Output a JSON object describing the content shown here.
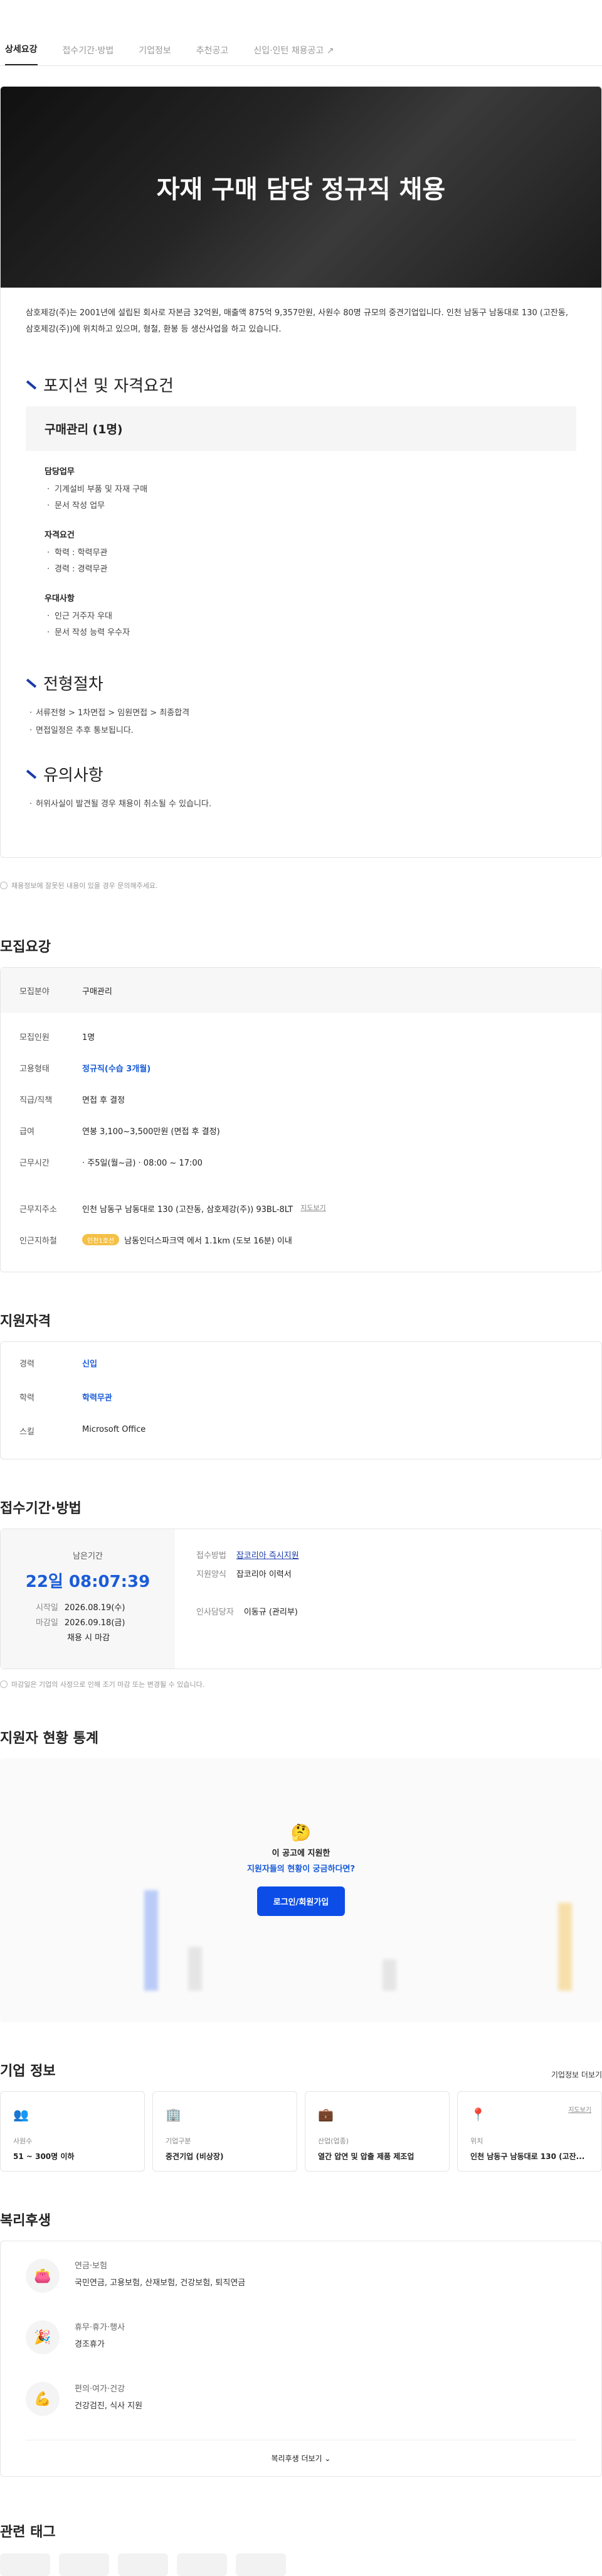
{
  "tabs": [
    "상세요강",
    "접수기간·방법",
    "기업정보",
    "추천공고",
    "신입·인턴 채용공고 ↗"
  ],
  "detail": {
    "hero_title": "자재 구매 담당 정규직 채용",
    "intro": "삼호제강(주)는 2001년에 설립된 회사로 자본금 32억원, 매출액 875억 9,357만원, 사원수 80명 규모의 중견기업입니다. 인천 남동구 남동대로 130 (고잔동, 삼호제강(주))에 위치하고 있으며, 형철, 환봉 등 생산사업을 하고 있습니다.",
    "position_heading": "포지션 및 자격요건",
    "position_title": "구매관리 (1명)",
    "sections": [
      {
        "title": "담당업무",
        "items": [
          "기계설비 부품 및 자재 구매",
          "문서 작성 업무"
        ]
      },
      {
        "title": "자격요건",
        "items": [
          "학력 : 학력무관",
          "경력 : 경력무관"
        ]
      },
      {
        "title": "우대사항",
        "items": [
          "인근 거주자 우대",
          "문서 작성 능력 우수자"
        ]
      }
    ],
    "process_heading": "전형절차",
    "process_items": [
      "서류전형 > 1차면접 > 임원면접 > 최종합격",
      "면접일정은 추후 통보됩니다."
    ],
    "caution_heading": "유의사항",
    "caution_items": [
      "허위사실이 발견될 경우 채용이 취소될 수 있습니다."
    ]
  },
  "notice_report": "채용정보에 잘못된 내용이 있을 경우 문의해주세요.",
  "recruit": {
    "heading": "모집요강",
    "rows": [
      {
        "k": "모집분야",
        "v": "구매관리"
      },
      {
        "k": "모집인원",
        "v": "1명"
      },
      {
        "k": "고용형태",
        "v": "정규직(수습 3개월)"
      },
      {
        "k": "직급/직책",
        "v": "면접 후 결정"
      },
      {
        "k": "급여",
        "v": "연봉 3,100~3,500만원 (면접 후 결정)"
      },
      {
        "k": "근무시간",
        "v": "· 주5일(월~금)  · 08:00 ~ 17:00"
      },
      {
        "k": "근무지주소",
        "v": "인천 남동구 남동대로 130 (고잔동, 삼호제강(주)) 93BL-8LT"
      },
      {
        "k": "인근지하철",
        "v": "남동인더스파크역 에서 1.1km (도보 16분) 이내"
      }
    ],
    "map_link": "지도보기",
    "subway_badge": "인천1호선"
  },
  "qualification": {
    "heading": "지원자격",
    "rows": [
      {
        "k": "경력",
        "v": "신입"
      },
      {
        "k": "학력",
        "v": "학력무관"
      },
      {
        "k": "스킬",
        "v": "Microsoft Office"
      }
    ]
  },
  "apply": {
    "heading": "접수기간·방법",
    "remain_label": "남은기간",
    "remain_value": "22일 08:07:39",
    "start_label": "시작일",
    "start_value": "2026.08.19(수)",
    "end_label": "마감일",
    "end_value": "2026.09.18(금)",
    "note": "채용 시 마감",
    "method_label": "접수방법",
    "method_value": "잡코리아 즉시지원",
    "form_label": "지원양식",
    "form_value": "잡코리아 이력서",
    "manager_label": "인사담당자",
    "manager_value": "이동규 (관리부)",
    "footnote": "마감일은 기업의 사정으로 인해 조기 마감 또는 변경될 수 있습니다."
  },
  "stats": {
    "heading": "지원자 현황 통계",
    "line1": "이 공고에 지원한",
    "line2": "지원자들의 현황이 궁금하다면?",
    "button": "로그인/회원가입"
  },
  "company": {
    "heading": "기업 정보",
    "more": "기업정보 더보기",
    "cards": [
      {
        "label": "사원수",
        "value": "51 ~ 300명 이하"
      },
      {
        "label": "기업구분",
        "value": "중견기업 (비상장)"
      },
      {
        "label": "산업(업종)",
        "value": "열간 압연 및 압출 제품 제조업"
      },
      {
        "label": "위치",
        "value": "인천 남동구 남동대로 130 (고잔..."
      }
    ],
    "map_link": "지도보기"
  },
  "welfare": {
    "heading": "복리후생",
    "items": [
      {
        "t": "연금·보험",
        "v": "국민연금, 고용보험, 산재보험, 건강보험, 퇴직연금"
      },
      {
        "t": "휴무·휴가·행사",
        "v": "경조휴가"
      },
      {
        "t": "편의·여가·건강",
        "v": "건강검진, 식사 지원"
      }
    ],
    "more": "복리후생 더보기"
  },
  "tags_heading": "관련 태그"
}
